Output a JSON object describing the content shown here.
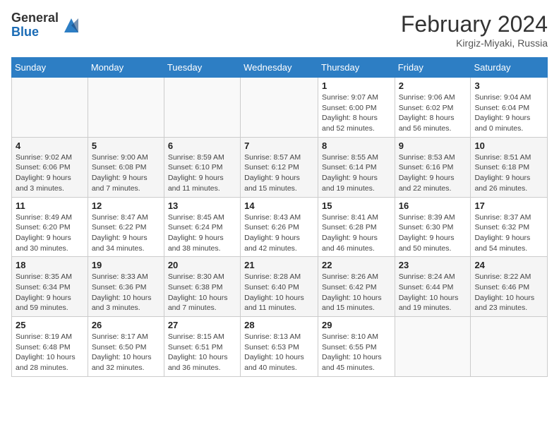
{
  "header": {
    "logo_general": "General",
    "logo_blue": "Blue",
    "month_year": "February 2024",
    "location": "Kirgiz-Miyaki, Russia"
  },
  "weekdays": [
    "Sunday",
    "Monday",
    "Tuesday",
    "Wednesday",
    "Thursday",
    "Friday",
    "Saturday"
  ],
  "weeks": [
    [
      {
        "day": "",
        "info": ""
      },
      {
        "day": "",
        "info": ""
      },
      {
        "day": "",
        "info": ""
      },
      {
        "day": "",
        "info": ""
      },
      {
        "day": "1",
        "info": "Sunrise: 9:07 AM\nSunset: 6:00 PM\nDaylight: 8 hours and 52 minutes."
      },
      {
        "day": "2",
        "info": "Sunrise: 9:06 AM\nSunset: 6:02 PM\nDaylight: 8 hours and 56 minutes."
      },
      {
        "day": "3",
        "info": "Sunrise: 9:04 AM\nSunset: 6:04 PM\nDaylight: 9 hours and 0 minutes."
      }
    ],
    [
      {
        "day": "4",
        "info": "Sunrise: 9:02 AM\nSunset: 6:06 PM\nDaylight: 9 hours and 3 minutes."
      },
      {
        "day": "5",
        "info": "Sunrise: 9:00 AM\nSunset: 6:08 PM\nDaylight: 9 hours and 7 minutes."
      },
      {
        "day": "6",
        "info": "Sunrise: 8:59 AM\nSunset: 6:10 PM\nDaylight: 9 hours and 11 minutes."
      },
      {
        "day": "7",
        "info": "Sunrise: 8:57 AM\nSunset: 6:12 PM\nDaylight: 9 hours and 15 minutes."
      },
      {
        "day": "8",
        "info": "Sunrise: 8:55 AM\nSunset: 6:14 PM\nDaylight: 9 hours and 19 minutes."
      },
      {
        "day": "9",
        "info": "Sunrise: 8:53 AM\nSunset: 6:16 PM\nDaylight: 9 hours and 22 minutes."
      },
      {
        "day": "10",
        "info": "Sunrise: 8:51 AM\nSunset: 6:18 PM\nDaylight: 9 hours and 26 minutes."
      }
    ],
    [
      {
        "day": "11",
        "info": "Sunrise: 8:49 AM\nSunset: 6:20 PM\nDaylight: 9 hours and 30 minutes."
      },
      {
        "day": "12",
        "info": "Sunrise: 8:47 AM\nSunset: 6:22 PM\nDaylight: 9 hours and 34 minutes."
      },
      {
        "day": "13",
        "info": "Sunrise: 8:45 AM\nSunset: 6:24 PM\nDaylight: 9 hours and 38 minutes."
      },
      {
        "day": "14",
        "info": "Sunrise: 8:43 AM\nSunset: 6:26 PM\nDaylight: 9 hours and 42 minutes."
      },
      {
        "day": "15",
        "info": "Sunrise: 8:41 AM\nSunset: 6:28 PM\nDaylight: 9 hours and 46 minutes."
      },
      {
        "day": "16",
        "info": "Sunrise: 8:39 AM\nSunset: 6:30 PM\nDaylight: 9 hours and 50 minutes."
      },
      {
        "day": "17",
        "info": "Sunrise: 8:37 AM\nSunset: 6:32 PM\nDaylight: 9 hours and 54 minutes."
      }
    ],
    [
      {
        "day": "18",
        "info": "Sunrise: 8:35 AM\nSunset: 6:34 PM\nDaylight: 9 hours and 59 minutes."
      },
      {
        "day": "19",
        "info": "Sunrise: 8:33 AM\nSunset: 6:36 PM\nDaylight: 10 hours and 3 minutes."
      },
      {
        "day": "20",
        "info": "Sunrise: 8:30 AM\nSunset: 6:38 PM\nDaylight: 10 hours and 7 minutes."
      },
      {
        "day": "21",
        "info": "Sunrise: 8:28 AM\nSunset: 6:40 PM\nDaylight: 10 hours and 11 minutes."
      },
      {
        "day": "22",
        "info": "Sunrise: 8:26 AM\nSunset: 6:42 PM\nDaylight: 10 hours and 15 minutes."
      },
      {
        "day": "23",
        "info": "Sunrise: 8:24 AM\nSunset: 6:44 PM\nDaylight: 10 hours and 19 minutes."
      },
      {
        "day": "24",
        "info": "Sunrise: 8:22 AM\nSunset: 6:46 PM\nDaylight: 10 hours and 23 minutes."
      }
    ],
    [
      {
        "day": "25",
        "info": "Sunrise: 8:19 AM\nSunset: 6:48 PM\nDaylight: 10 hours and 28 minutes."
      },
      {
        "day": "26",
        "info": "Sunrise: 8:17 AM\nSunset: 6:50 PM\nDaylight: 10 hours and 32 minutes."
      },
      {
        "day": "27",
        "info": "Sunrise: 8:15 AM\nSunset: 6:51 PM\nDaylight: 10 hours and 36 minutes."
      },
      {
        "day": "28",
        "info": "Sunrise: 8:13 AM\nSunset: 6:53 PM\nDaylight: 10 hours and 40 minutes."
      },
      {
        "day": "29",
        "info": "Sunrise: 8:10 AM\nSunset: 6:55 PM\nDaylight: 10 hours and 45 minutes."
      },
      {
        "day": "",
        "info": ""
      },
      {
        "day": "",
        "info": ""
      }
    ]
  ]
}
